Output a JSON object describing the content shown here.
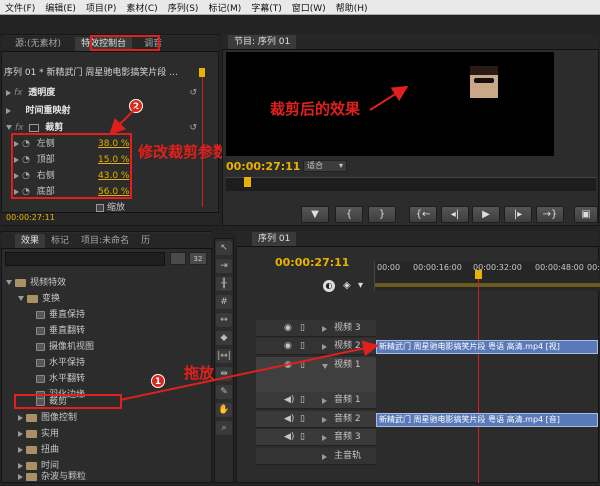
{
  "menu": [
    "文件(F)",
    "编辑(E)",
    "项目(P)",
    "素材(C)",
    "序列(S)",
    "标记(M)",
    "字幕(T)",
    "窗口(W)",
    "帮助(H)"
  ],
  "source_panel": {
    "tabs": [
      "源:(无素材)",
      "特效控制台",
      "调音"
    ],
    "sequence_header": "序列 01 * 新精武门 周星驰电影搞笑片段 ...",
    "opacity": "透明度",
    "time_remap": "时间重映射",
    "crop": "裁剪",
    "params": [
      {
        "label": "左侧",
        "value": "38.0 %"
      },
      {
        "label": "顶部",
        "value": "15.0 %"
      },
      {
        "label": "右侧",
        "value": "43.0 %"
      },
      {
        "label": "底部",
        "value": "56.0 %"
      }
    ],
    "zoom_label": "缩放",
    "timecode": "00:00:27:11"
  },
  "program_panel": {
    "tab": "节目: 序列 01",
    "timecode": "00:00:27:11",
    "fit": "适合"
  },
  "effects_panel": {
    "tabs": [
      "效果",
      "标记",
      "项目:未命名",
      "历"
    ],
    "top_item": "视频特效",
    "folder_transform": "变换",
    "items": [
      "垂直保持",
      "垂直翻转",
      "摄像机视图",
      "水平保持",
      "水平翻转",
      "羽化边缘",
      "裁剪"
    ],
    "folders": [
      "图像控制",
      "实用",
      "扭曲",
      "时间",
      "杂波与颗粒"
    ]
  },
  "timeline": {
    "tab": "序列 01",
    "timecode": "00:00:27:11",
    "ruler": [
      "00:00",
      "00:00:16:00",
      "00:00:32:00",
      "00:00:48:00",
      "00:0"
    ],
    "tracks": [
      "视频 3",
      "视频 2",
      "视频 1",
      "音频 1",
      "音频 2",
      "音频 3",
      "主音轨"
    ],
    "video_clip": "新精武门 周星驰电影搞笑片段 粤语 高清.mp4 [视]",
    "audio_clip": "新精武门 周星驰电影搞笑片段 粤语 高清.mp4 [音]"
  },
  "annotations": {
    "crop_result": "裁剪后的效果",
    "modify_params": "修改裁剪参数",
    "drag": "拖放",
    "num1": "1",
    "num2": "2"
  },
  "colors": {
    "accent": "#e8b200",
    "annotation": "#e0201c",
    "clip": "#5a79b8"
  }
}
